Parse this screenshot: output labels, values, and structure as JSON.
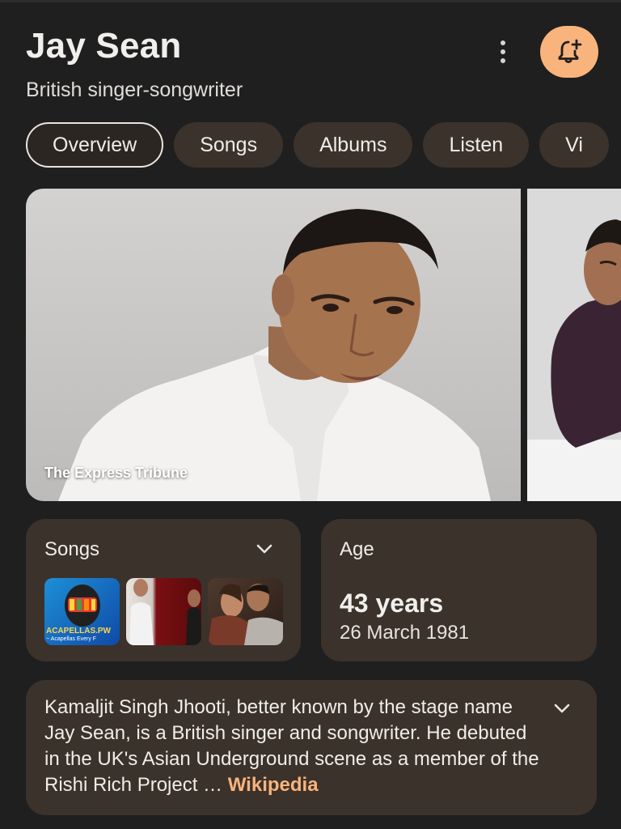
{
  "header": {
    "title": "Jay Sean",
    "subtitle": "British singer-songwriter"
  },
  "icons": {
    "more": "more-vert-icon",
    "bell": "notification-add-icon",
    "chevron": "chevron-down-icon"
  },
  "tabs": [
    {
      "label": "Overview",
      "active": true
    },
    {
      "label": "Songs"
    },
    {
      "label": "Albums"
    },
    {
      "label": "Listen"
    },
    {
      "label": "Vi"
    }
  ],
  "images": {
    "main_caption": "The Express Tribune"
  },
  "songs_card": {
    "label": "Songs",
    "thumbnails": [
      {
        "text_line1": "ACAPELLAS.PW",
        "text_line2": "~ Acapellas Every F"
      },
      {},
      {}
    ]
  },
  "age_card": {
    "label": "Age",
    "value": "43 years",
    "date": "26 March 1981"
  },
  "description": {
    "text": "Kamaljit Singh Jhooti, better known by the stage name Jay Sean, is a British singer and songwriter. He debuted in the UK's Asian Underground scene as a member of the Rishi Rich Project",
    "ellipsis": " … ",
    "source": "Wikipedia"
  },
  "colors": {
    "background": "#1f1f1f",
    "card": "#3b322b",
    "accent": "#f8b47c"
  }
}
